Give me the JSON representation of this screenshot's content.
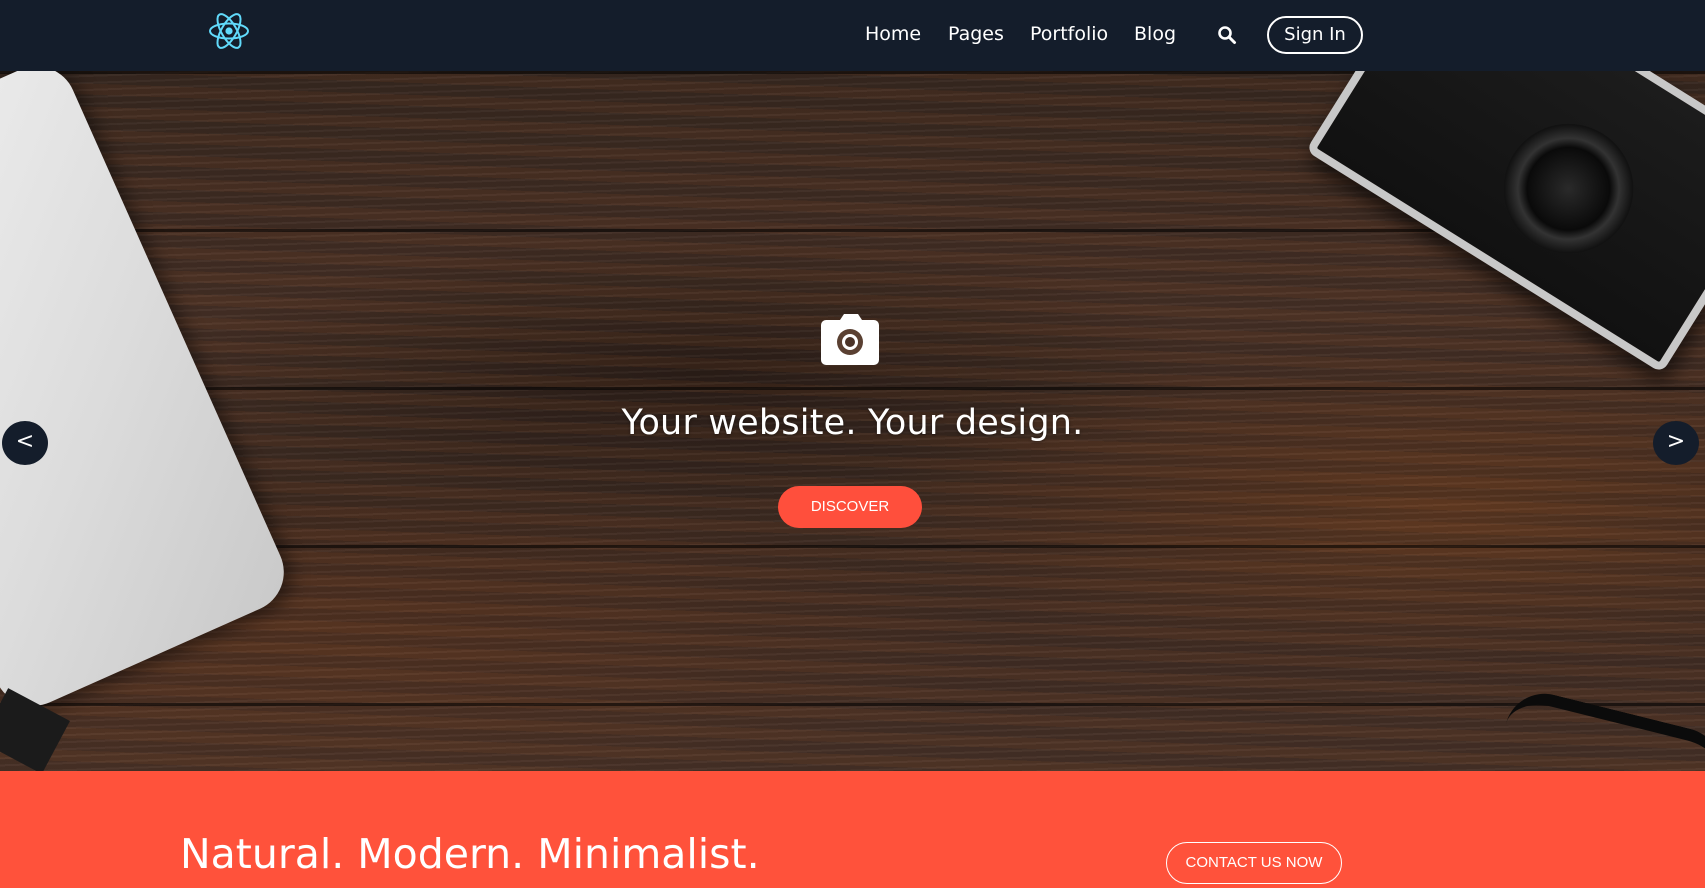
{
  "nav": {
    "links": [
      "Home",
      "Pages",
      "Portfolio",
      "Blog"
    ],
    "signin_label": "Sign In"
  },
  "hero": {
    "title": "Your website. Your design.",
    "cta_label": "DISCOVER",
    "prev_label": "<",
    "next_label": ">"
  },
  "banner": {
    "title": "Natural. Modern. Minimalist.",
    "cta_label": "CONTACT US NOW"
  },
  "colors": {
    "nav_bg": "#141d2b",
    "accent": "#ff523b",
    "logo": "#61dafb"
  },
  "icons": [
    "react-logo-icon",
    "search-icon",
    "camera-icon"
  ]
}
